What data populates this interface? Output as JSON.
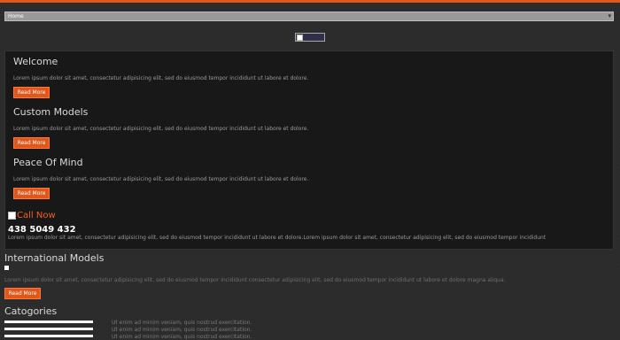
{
  "nav": {
    "selected": "Home"
  },
  "sections": [
    {
      "title": "Welcome",
      "text": "Lorem ipsum dolor sit amet, consectetur adipisicing elit, sed do eiusmod tempor incididunt ut labore et dolore.",
      "button": "Read More"
    },
    {
      "title": "Custom Models",
      "text": "Lorem ipsum dolor sit amet, consectetur adipisicing elit, sed do eiusmod tempor incididunt ut labore et dolore.",
      "button": "Read More"
    },
    {
      "title": "Peace Of Mind",
      "text": "Lorem ipsum dolor sit amet, consectetur adipisicing elit, sed do eiusmod tempor incididunt ut labore et dolore.",
      "button": "Read More"
    }
  ],
  "contact": {
    "call_now": "Call Now",
    "phone": "438 5049 432",
    "text": "Lorem ipsum dolor sit amet, consectetur adipisicing elit, sed do eiusmod tempor incididunt ut labore et dolore.Lorem ipsum dolor sit amet, consectetur adipisicing elit, sed do eiusmod tempor incididunt"
  },
  "international": {
    "title": "International Models",
    "text": "Lorem ipsum dolor sit amet, consectetur adipisicing elit, sed do eiusmod tempor incididunt consectetur adipisicing elit, sed do eiusmod tempor incididunt ut labore et dolore magna aliqua.",
    "button": "Read More"
  },
  "categories": {
    "title": "Catogories",
    "items": [
      "Ut enim ad minim veniam, quis nostrud exercitation.",
      "Ut enim ad minim veniam, quis nostrud exercitation.",
      "Ut enim ad minim veniam, quis nostrud exercitation."
    ]
  },
  "colors": {
    "accent": "#e2561a",
    "background": "#2b2b2b",
    "panel": "#181818"
  }
}
